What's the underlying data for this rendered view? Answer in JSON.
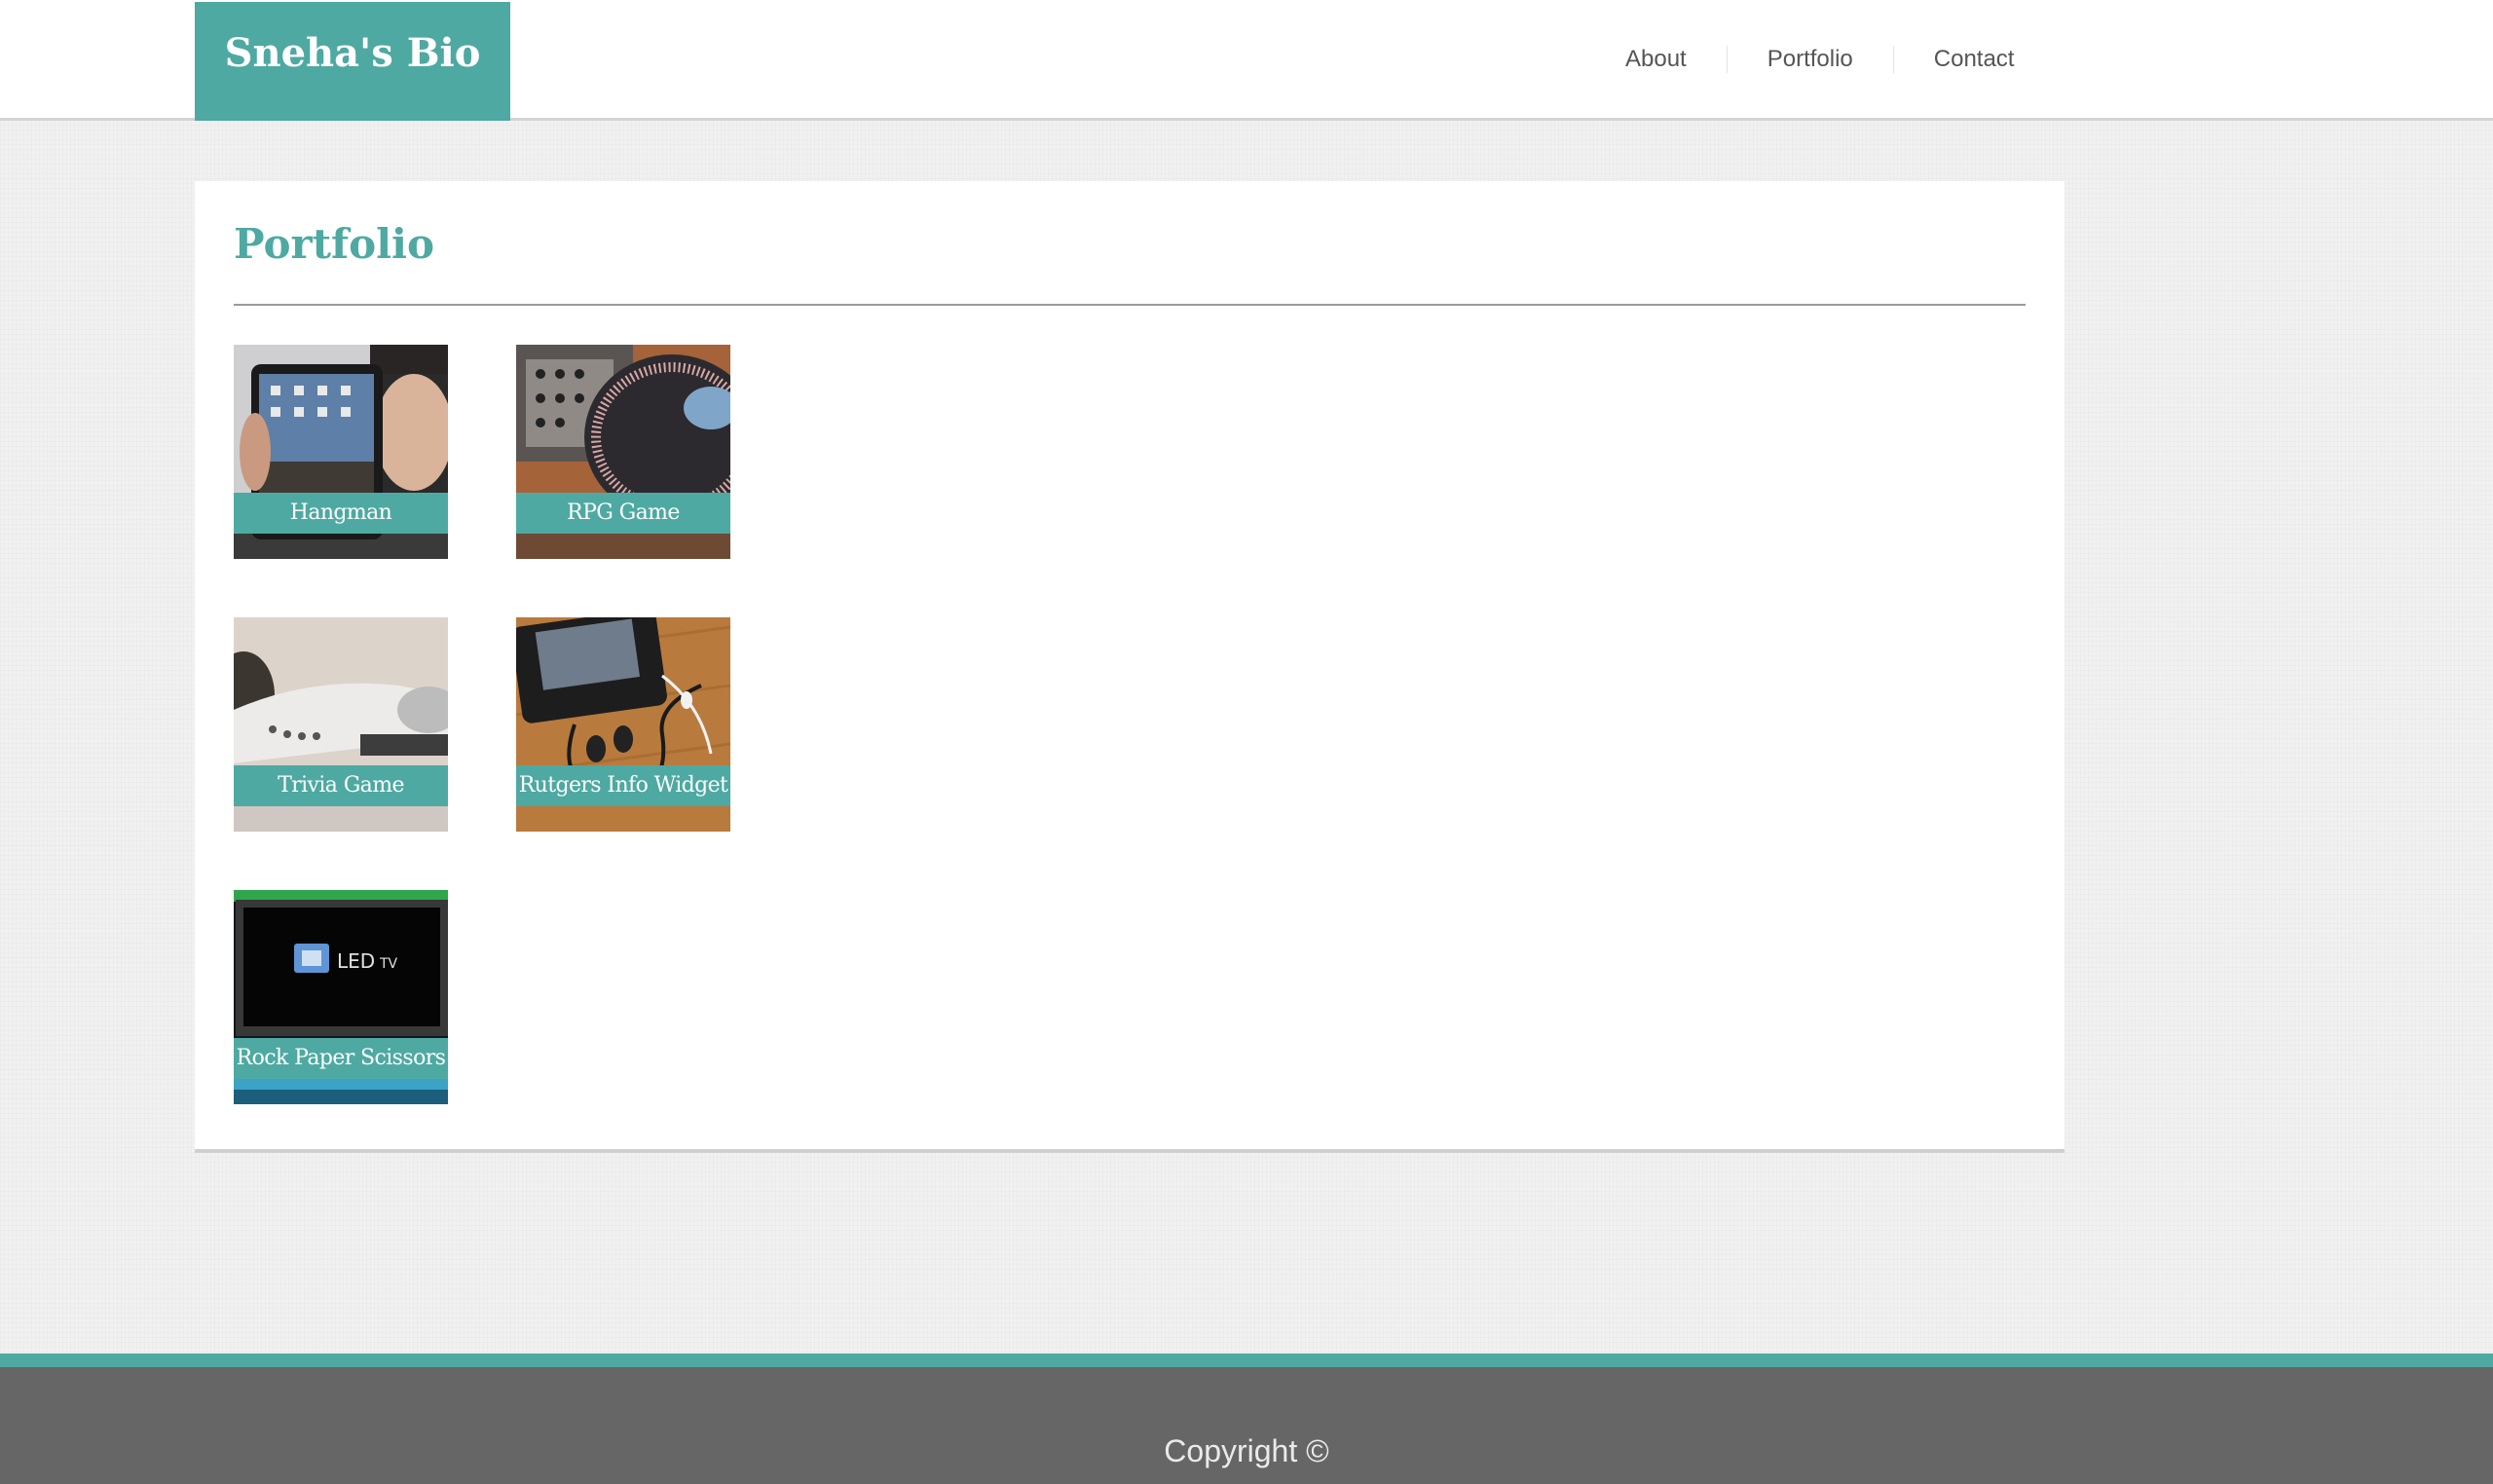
{
  "header": {
    "brand": "Sneha's Bio",
    "nav": [
      "About",
      "Portfolio",
      "Contact"
    ]
  },
  "main": {
    "title": "Portfolio",
    "projects": [
      {
        "label": "Hangman",
        "image": "tablet-photo"
      },
      {
        "label": "RPG Game",
        "image": "turntable-photo"
      },
      {
        "label": "Trivia Game",
        "image": "earbuds-photo"
      },
      {
        "label": "Rutgers Info Widget",
        "image": "phone-headphones-photo"
      },
      {
        "label": "Rock Paper Scissors",
        "image": "led-tv-photo"
      }
    ]
  },
  "footer": {
    "copyright": "Copyright ©"
  },
  "colors": {
    "accent": "#4ea9a2",
    "footer": "#666666"
  }
}
